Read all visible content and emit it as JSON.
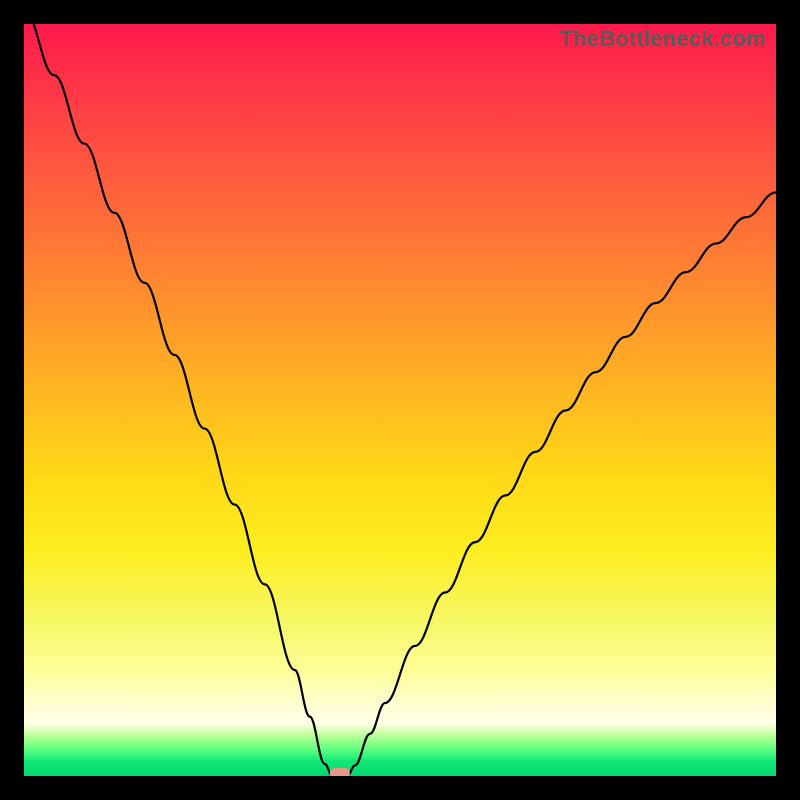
{
  "meta": {
    "watermark": "TheBottleneck.com"
  },
  "chart_data": {
    "type": "line",
    "title": "",
    "xlabel": "",
    "ylabel": "",
    "xlim": [
      0,
      100
    ],
    "ylim": [
      0,
      100
    ],
    "grid": false,
    "x": [
      0,
      4,
      8,
      12,
      16,
      20,
      24,
      28,
      32,
      36,
      38,
      40,
      41,
      42,
      43,
      44,
      46,
      48,
      52,
      56,
      60,
      64,
      68,
      72,
      76,
      80,
      84,
      88,
      92,
      96,
      100
    ],
    "values": [
      102,
      93.2,
      84.1,
      74.9,
      65.6,
      56.0,
      46.2,
      36.1,
      25.5,
      14.1,
      7.9,
      1.6,
      0.0,
      0.0,
      0.0,
      1.4,
      5.6,
      9.7,
      17.3,
      24.4,
      31.1,
      37.3,
      43.1,
      48.6,
      53.7,
      58.4,
      62.9,
      67.0,
      70.8,
      74.3,
      77.6
    ],
    "minimum_marker": {
      "x": 42,
      "y": 0
    },
    "colors": {
      "curve": "#000000",
      "marker": "#e9958a",
      "gradient_top": "#ff1a4b",
      "gradient_bottom": "#04d66e"
    }
  }
}
